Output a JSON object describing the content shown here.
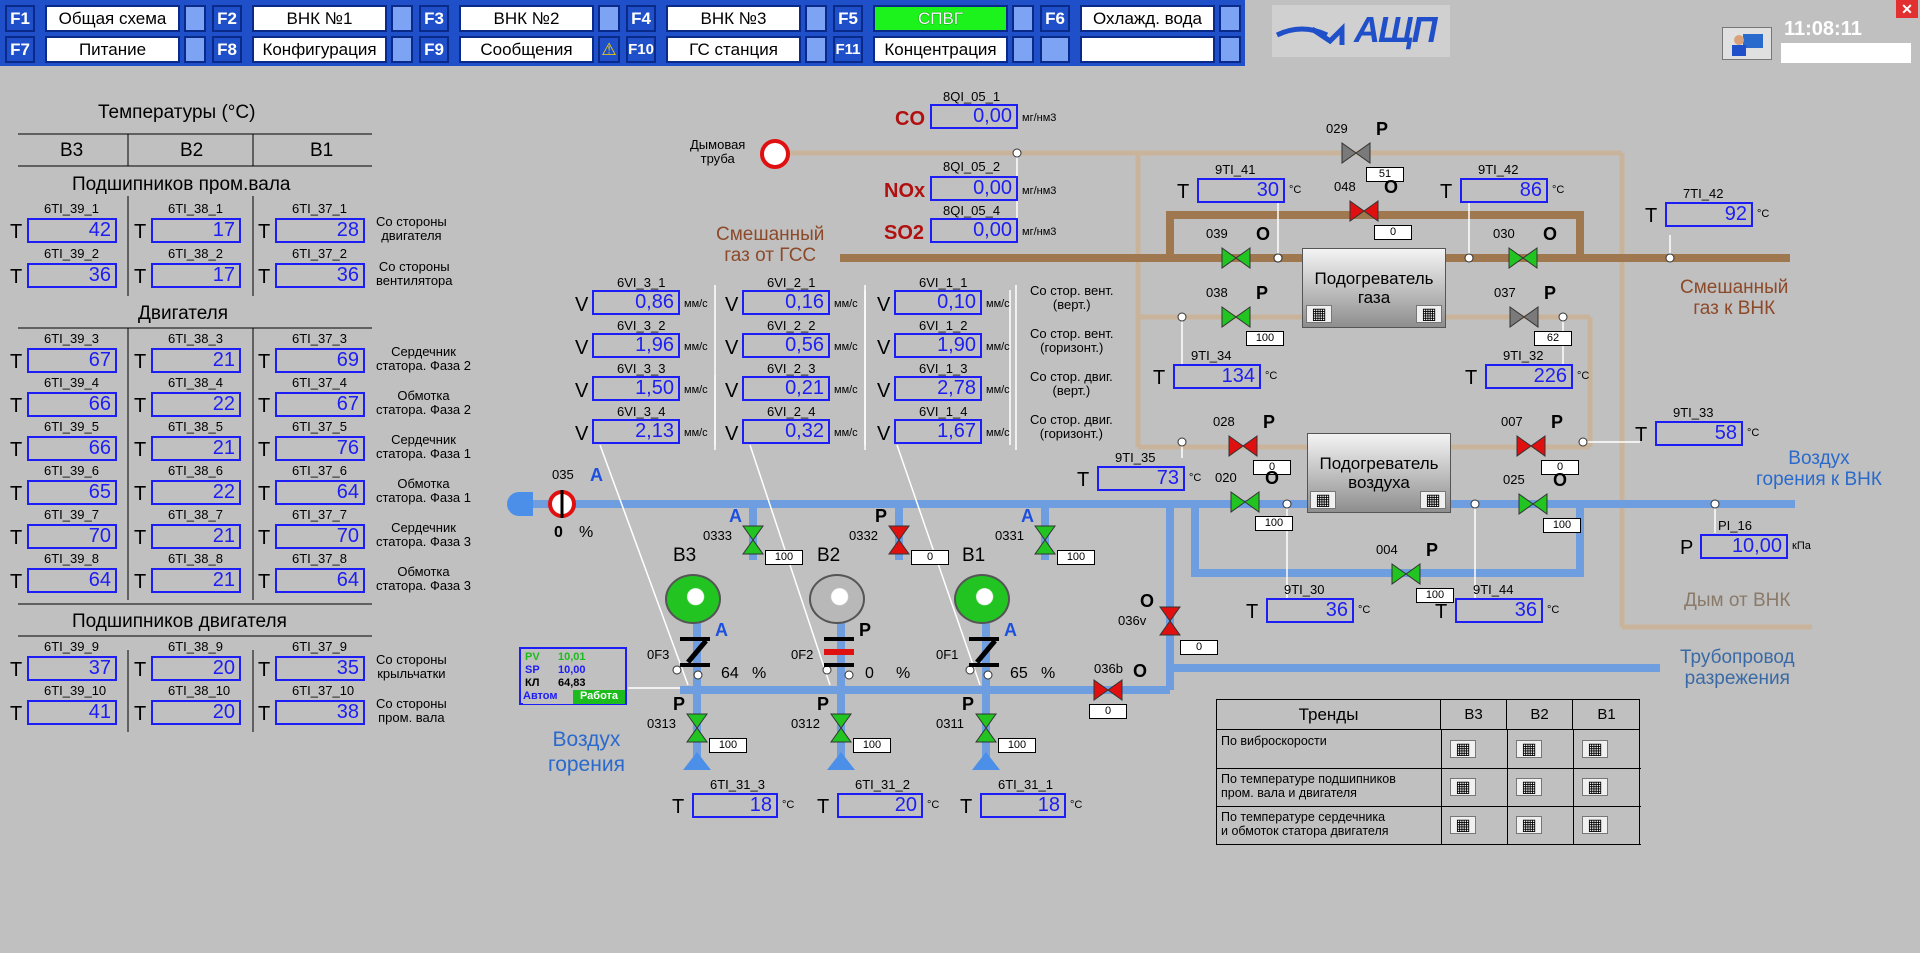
{
  "toolbar": {
    "row1": [
      {
        "key": "F1",
        "label": "Общая схема"
      },
      {
        "key": "F2",
        "label": "ВНК №1"
      },
      {
        "key": "F3",
        "label": "ВНК №2"
      },
      {
        "key": "F4",
        "label": "ВНК №3"
      },
      {
        "key": "F5",
        "label": "СПВГ"
      },
      {
        "key": "F6",
        "label": "Охлажд. вода"
      }
    ],
    "row2": [
      {
        "key": "F7",
        "label": "Питание"
      },
      {
        "key": "F8",
        "label": "Конфигурация"
      },
      {
        "key": "F9",
        "label": "Сообщения"
      },
      {
        "key": "F10",
        "label": "ГС станция"
      },
      {
        "key": "F11",
        "label": "Концентрация"
      },
      {
        "key": "",
        "label": ""
      }
    ],
    "active": "F5",
    "warning_icon": "warning-icon",
    "logo_text": "АЩП",
    "clock": "11:08:11",
    "operator_icon": "operator-icon",
    "close_icon": "close-icon"
  },
  "temps": {
    "title": "Температуры (°C)",
    "cols": [
      "В3",
      "В2",
      "В1"
    ],
    "sections": [
      {
        "title": "Подшипников пром.вала",
        "rows": [
          {
            "tags": [
              "6TI_39_1",
              "6TI_38_1",
              "6TI_37_1"
            ],
            "values": [
              "42",
              "17",
              "28"
            ],
            "desc": "Со стороны\nдвигателя"
          },
          {
            "tags": [
              "6TI_39_2",
              "6TI_38_2",
              "6TI_37_2"
            ],
            "values": [
              "36",
              "17",
              "36"
            ],
            "desc": "Со стороны\nвентилятора"
          }
        ]
      },
      {
        "title": "Двигателя",
        "rows": [
          {
            "tags": [
              "6TI_39_3",
              "6TI_38_3",
              "6TI_37_3"
            ],
            "values": [
              "67",
              "21",
              "69"
            ],
            "desc": "Сердечник\nстатора. Фаза 2"
          },
          {
            "tags": [
              "6TI_39_4",
              "6TI_38_4",
              "6TI_37_4"
            ],
            "values": [
              "66",
              "22",
              "67"
            ],
            "desc": "Обмотка\nстатора. Фаза 2"
          },
          {
            "tags": [
              "6TI_39_5",
              "6TI_38_5",
              "6TI_37_5"
            ],
            "values": [
              "66",
              "21",
              "76"
            ],
            "desc": "Сердечник\nстатора. Фаза 1"
          },
          {
            "tags": [
              "6TI_39_6",
              "6TI_38_6",
              "6TI_37_6"
            ],
            "values": [
              "65",
              "22",
              "64"
            ],
            "desc": "Обмотка\nстатора. Фаза 1"
          },
          {
            "tags": [
              "6TI_39_7",
              "6TI_38_7",
              "6TI_37_7"
            ],
            "values": [
              "70",
              "21",
              "70"
            ],
            "desc": "Сердечник\nстатора. Фаза 3"
          },
          {
            "tags": [
              "6TI_39_8",
              "6TI_38_8",
              "6TI_37_8"
            ],
            "values": [
              "64",
              "21",
              "64"
            ],
            "desc": "Обмотка\nстатора. Фаза 3"
          }
        ]
      },
      {
        "title": "Подшипников двигателя",
        "rows": [
          {
            "tags": [
              "6TI_39_9",
              "6TI_38_9",
              "6TI_37_9"
            ],
            "values": [
              "37",
              "20",
              "35"
            ],
            "desc": "Со стороны\nкрыльчатки"
          },
          {
            "tags": [
              "6TI_39_10",
              "6TI_38_10",
              "6TI_37_10"
            ],
            "values": [
              "41",
              "20",
              "38"
            ],
            "desc": "Со стороны\nпром. вала"
          }
        ]
      }
    ],
    "prefix": "T"
  },
  "vib": {
    "cols": [
      [
        {
          "tag": "6VI_3_1",
          "value": "0,86"
        },
        {
          "tag": "6VI_3_2",
          "value": "1,96"
        },
        {
          "tag": "6VI_3_3",
          "value": "1,50"
        },
        {
          "tag": "6VI_3_4",
          "value": "2,13"
        }
      ],
      [
        {
          "tag": "6VI_2_1",
          "value": "0,16"
        },
        {
          "tag": "6VI_2_2",
          "value": "0,56"
        },
        {
          "tag": "6VI_2_3",
          "value": "0,21"
        },
        {
          "tag": "6VI_2_4",
          "value": "0,32"
        }
      ],
      [
        {
          "tag": "6VI_1_1",
          "value": "0,10"
        },
        {
          "tag": "6VI_1_2",
          "value": "1,90"
        },
        {
          "tag": "6VI_1_3",
          "value": "2,78"
        },
        {
          "tag": "6VI_1_4",
          "value": "1,67"
        }
      ]
    ],
    "unit": "мм/с",
    "prefix": "V",
    "desc": [
      "Со стор. вент.\n(верт.)",
      "Со стор. вент.\n(горизонт.)",
      "Со стор. двиг.\n(верт.)",
      "Со стор. двиг.\n(горизонт.)"
    ]
  },
  "gas": {
    "co": {
      "label": "CO",
      "tag": "8QI_05_1",
      "value": "0,00",
      "unit": "мг/нм3"
    },
    "nox": {
      "label": "NOx",
      "tag": "8QI_05_2",
      "value": "0,00",
      "unit": "мг/нм3"
    },
    "so2": {
      "label": "SO2",
      "tag": "8QI_05_4",
      "value": "0,00",
      "unit": "мг/нм3"
    },
    "chimney": "Дымовая\nтруба",
    "mixed_in": "Смешанный\nгаз от ГСС",
    "mixed_out": "Смешанный\nгаз к ВНК",
    "air_out": "Воздух\nгорения к ВНК",
    "smoke": "Дым от ВНК",
    "vacuum": "Трубопровод\nразрежения",
    "air_in": "Воздух\nгорения"
  },
  "sensors": [
    {
      "id": "9TI_41",
      "prefix": "T",
      "value": "30",
      "unit": "°C"
    },
    {
      "id": "9TI_42",
      "prefix": "T",
      "value": "86",
      "unit": "°C"
    },
    {
      "id": "7TI_42",
      "prefix": "T",
      "value": "92",
      "unit": "°C"
    },
    {
      "id": "9TI_34",
      "prefix": "T",
      "value": "134",
      "unit": "°C"
    },
    {
      "id": "9TI_32",
      "prefix": "T",
      "value": "226",
      "unit": "°C"
    },
    {
      "id": "9TI_33",
      "prefix": "T",
      "value": "58",
      "unit": "°C"
    },
    {
      "id": "9TI_35",
      "prefix": "T",
      "value": "73",
      "unit": "°C"
    },
    {
      "id": "PI_16",
      "prefix": "P",
      "value": "10,00",
      "unit": "кПа"
    },
    {
      "id": "9TI_30",
      "prefix": "T",
      "value": "36",
      "unit": "°C"
    },
    {
      "id": "9TI_44",
      "prefix": "T",
      "value": "36",
      "unit": "°C"
    },
    {
      "id": "6TI_31_3",
      "prefix": "T",
      "value": "18",
      "unit": "°C"
    },
    {
      "id": "6TI_31_2",
      "prefix": "T",
      "value": "20",
      "unit": "°C"
    },
    {
      "id": "6TI_31_1",
      "prefix": "T",
      "value": "18",
      "unit": "°C"
    }
  ],
  "valves": [
    {
      "id": "029",
      "mode": "P",
      "pct": "51"
    },
    {
      "id": "048",
      "mode": "O",
      "pct": "0"
    },
    {
      "id": "039",
      "mode": "O"
    },
    {
      "id": "030",
      "mode": "O"
    },
    {
      "id": "038",
      "mode": "P",
      "pct": "100"
    },
    {
      "id": "037",
      "mode": "P",
      "pct": "62"
    },
    {
      "id": "028",
      "mode": "P",
      "pct": "0"
    },
    {
      "id": "007",
      "mode": "P",
      "pct": "0"
    },
    {
      "id": "020",
      "mode": "O",
      "pct": "100"
    },
    {
      "id": "025",
      "mode": "O",
      "pct": "100"
    },
    {
      "id": "004",
      "mode": "P",
      "pct": "100"
    },
    {
      "id": "036v",
      "mode": "O",
      "pct": "0"
    },
    {
      "id": "036b",
      "mode": "O",
      "pct": "0"
    },
    {
      "id": "035",
      "mode": "A",
      "pct": "0",
      "unit": "%"
    },
    {
      "id": "0333",
      "mode": "A",
      "pct": "100"
    },
    {
      "id": "0332",
      "mode": "P",
      "pct": "0"
    },
    {
      "id": "0331",
      "mode": "A",
      "pct": "100"
    },
    {
      "id": "0313",
      "mode": "P",
      "pct": "100"
    },
    {
      "id": "0312",
      "mode": "P",
      "pct": "100"
    },
    {
      "id": "0311",
      "mode": "P",
      "pct": "100"
    }
  ],
  "heaters": {
    "gas": "Подогреватель\nгаза",
    "air": "Подогреватель\nвоздуха"
  },
  "fans": [
    {
      "name": "В3",
      "mode": "A",
      "damper": "0F3",
      "pct": "64",
      "unit": "%"
    },
    {
      "name": "В2",
      "mode": "P",
      "damper": "0F2",
      "pct": "0",
      "unit": "%"
    },
    {
      "name": "В1",
      "mode": "A",
      "damper": "0F1",
      "pct": "65",
      "unit": "%"
    }
  ],
  "pid": {
    "pv_label": "PV",
    "pv": "10,01",
    "sp_label": "SP",
    "sp": "10,00",
    "kl_label": "КЛ",
    "kl": "64,83",
    "mode": "Автом",
    "state": "Работа"
  },
  "trends": {
    "title": "Тренды",
    "cols": [
      "В3",
      "В2",
      "В1"
    ],
    "rows": [
      "По виброскорости",
      "По температуре подшипников\nпром. вала и двигателя",
      "По температуре сердечника\nи обмоток статора двигателя"
    ]
  },
  "colors": {
    "pipe_gas": "#a07850",
    "pipe_air": "#6495dc",
    "valve_open": "#22c422",
    "valve_closed": "#e01010",
    "value_border": "#1d1df5",
    "label_brown": "#8c4a2a",
    "label_blue": "#2a6acc"
  }
}
